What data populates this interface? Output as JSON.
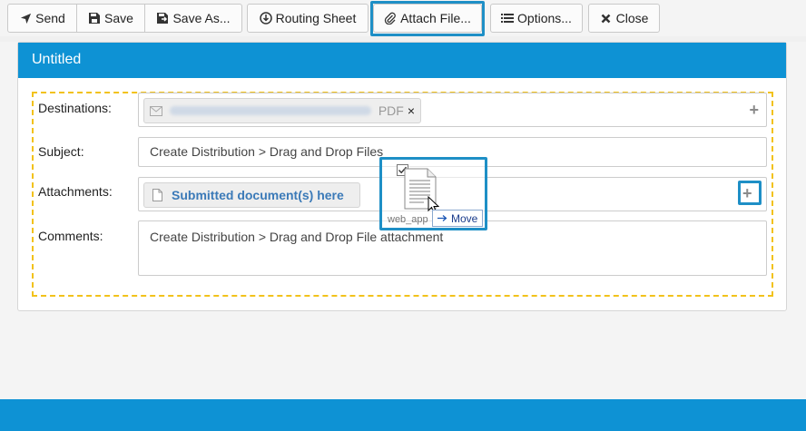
{
  "toolbar": {
    "send": "Send",
    "save": "Save",
    "save_as": "Save As...",
    "routing_sheet": "Routing Sheet",
    "attach_file": "Attach File...",
    "options": "Options...",
    "close": "Close"
  },
  "panel": {
    "title": "Untitled"
  },
  "form": {
    "destinations_label": "Destinations:",
    "destination_chip": {
      "format": "PDF",
      "remove": "×"
    },
    "subject_label": "Subject:",
    "subject_value": "Create Distribution > Drag and Drop Files",
    "attachments_label": "Attachments:",
    "attachment_chip": "Submitted document(s) here",
    "comments_label": "Comments:",
    "comments_value": "Create Distribution > Drag and Drop File attachment"
  },
  "drag": {
    "file_label": "web_app",
    "action": "Move"
  },
  "colors": {
    "accent": "#0e92d4",
    "highlight": "#1e8fc6",
    "dashed_border": "#f2c21b"
  }
}
